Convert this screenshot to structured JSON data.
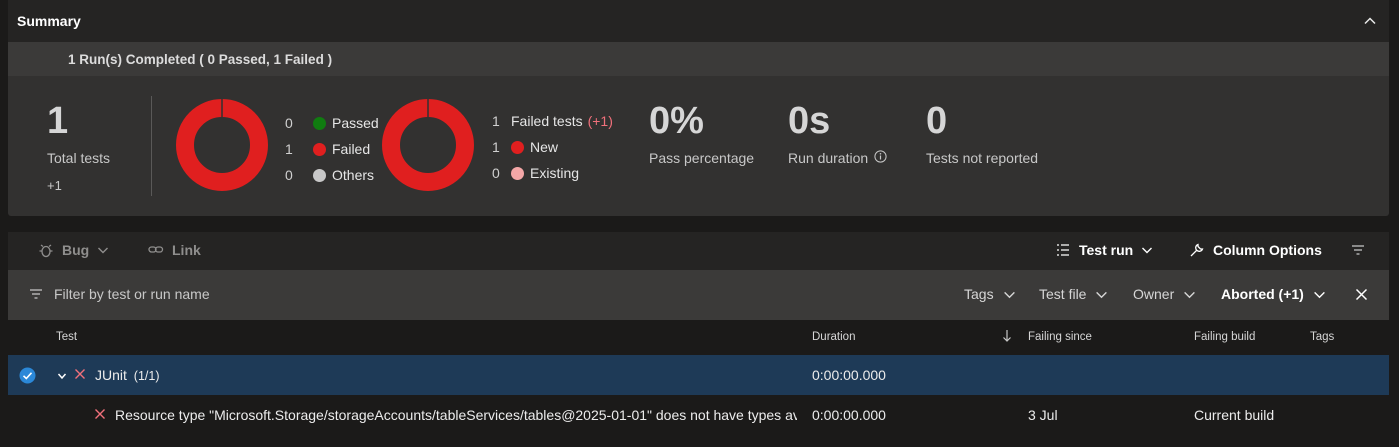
{
  "summary": {
    "title": "Summary",
    "run_banner": "1 Run(s) Completed ( 0 Passed, 1 Failed )",
    "total_tests": {
      "value": "1",
      "label": "Total tests",
      "delta": "+1"
    },
    "outcome_legend": [
      {
        "count": "0",
        "label": "Passed",
        "color": "#107c10"
      },
      {
        "count": "1",
        "label": "Failed",
        "color": "#e01f1f"
      },
      {
        "count": "0",
        "label": "Others",
        "color": "#c8c8c8"
      }
    ],
    "failed_legend": {
      "header_count": "1",
      "header_label": "Failed tests",
      "header_delta": "(+1)",
      "rows": [
        {
          "count": "1",
          "label": "New",
          "color": "#e01f1f"
        },
        {
          "count": "0",
          "label": "Existing",
          "color": "#f4a7a7"
        }
      ]
    },
    "pass_percentage": {
      "value": "0%",
      "label": "Pass percentage"
    },
    "run_duration": {
      "value": "0s",
      "label": "Run duration"
    },
    "not_reported": {
      "value": "0",
      "label": "Tests not reported"
    },
    "donut_color": "#e01f1f"
  },
  "toolbar": {
    "bug_label": "Bug",
    "link_label": "Link",
    "test_run_label": "Test run",
    "column_options_label": "Column Options"
  },
  "filters": {
    "placeholder": "Filter by test or run name",
    "tags_label": "Tags",
    "test_file_label": "Test file",
    "owner_label": "Owner",
    "aborted_label": "Aborted (+1)"
  },
  "table": {
    "headers": {
      "test": "Test",
      "duration": "Duration",
      "failing_since": "Failing since",
      "failing_build": "Failing build",
      "tags": "Tags"
    },
    "group_row": {
      "name": "JUnit",
      "count": "(1/1)",
      "duration": "0:00:00.000"
    },
    "child_row": {
      "name": "Resource type \"Microsoft.Storage/storageAccounts/tableServices/tables@2025-01-01\" does not have types ava",
      "duration": "0:00:00.000",
      "failing_since": "3 Jul",
      "failing_build": "Current build"
    }
  }
}
